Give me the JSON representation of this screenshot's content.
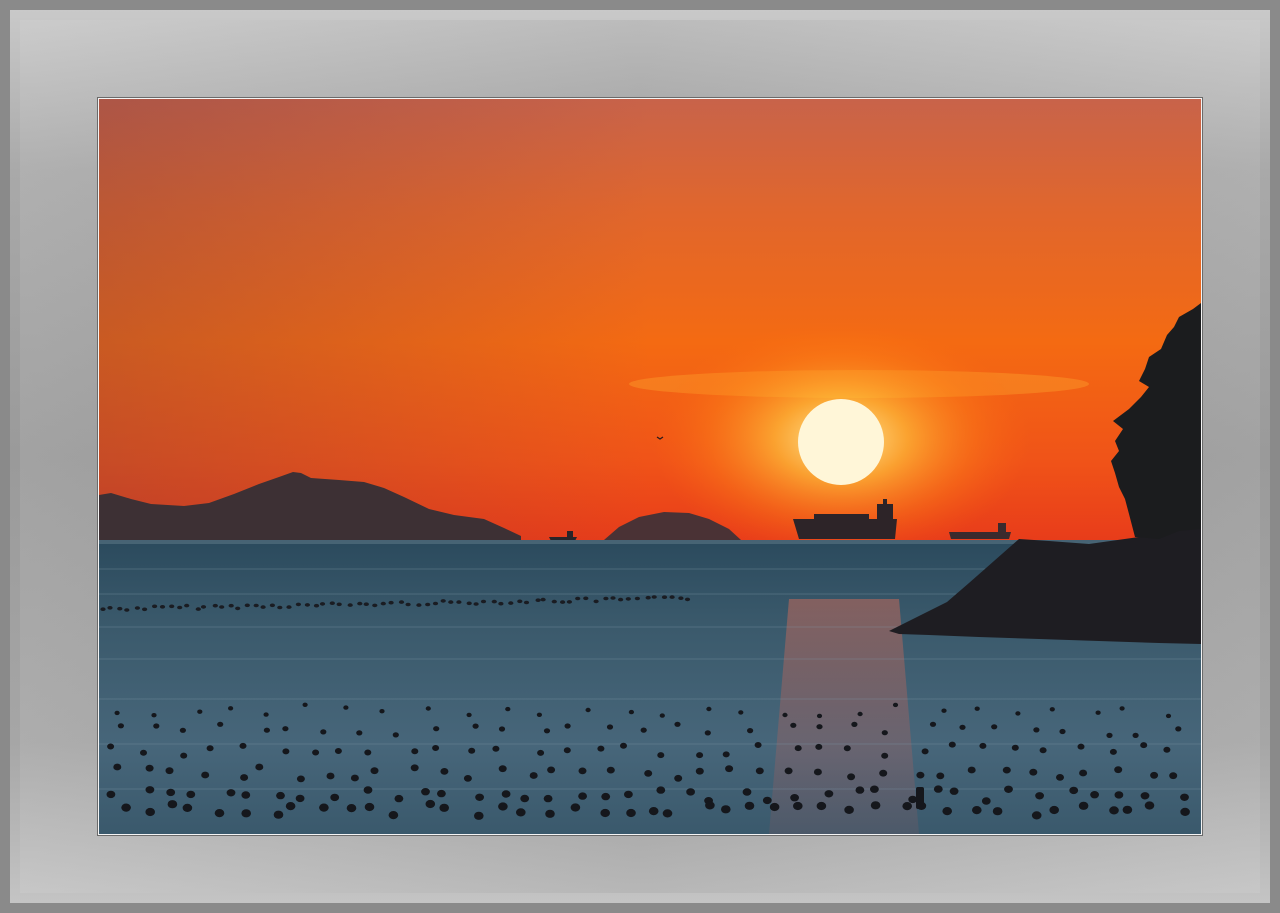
{
  "scene": {
    "subject": "sunset over sea",
    "colors": {
      "sky_top": "#c8634a",
      "sky_mid": "#f26a1b",
      "sky_horizon": "#ee4a17",
      "sun": "#fff6d8",
      "sea": "#2d4958",
      "sea_light": "#506c7d",
      "silhouette": "#1c1e24",
      "mountain": "#3d3135",
      "frame": "#a6a6a6"
    },
    "elements": [
      "sun-icon",
      "mountain-island",
      "small-island",
      "cargo-ship",
      "tree-silhouette",
      "rock-outcrop",
      "buoy-rows",
      "bird"
    ]
  }
}
